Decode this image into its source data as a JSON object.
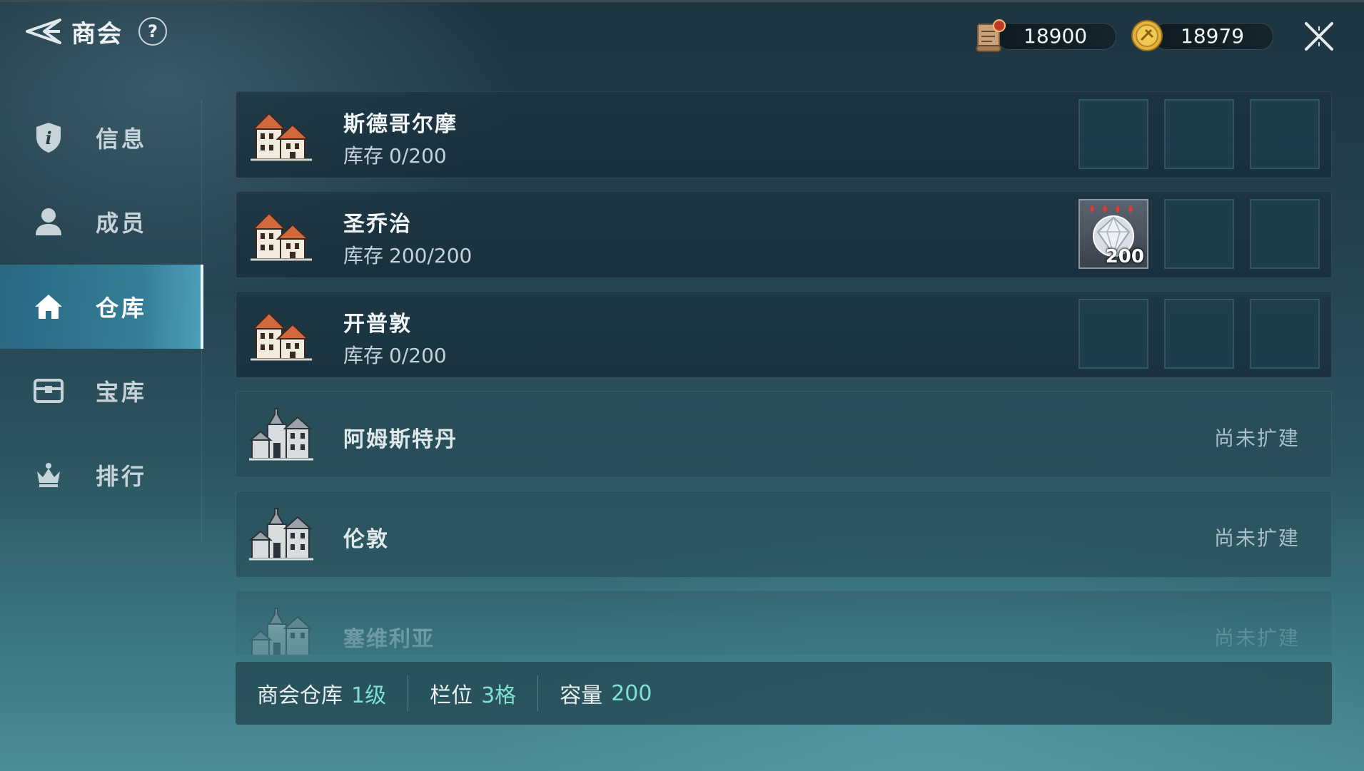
{
  "header": {
    "title": "商会",
    "help_label": "?",
    "currency_scroll_value": "18900",
    "currency_gold_value": "18979"
  },
  "sidebar": {
    "items": [
      {
        "label": "信息",
        "icon": "info-shield-icon",
        "active": false
      },
      {
        "label": "成员",
        "icon": "person-icon",
        "active": false
      },
      {
        "label": "仓库",
        "icon": "home-icon",
        "active": true
      },
      {
        "label": "宝库",
        "icon": "chest-icon",
        "active": false
      },
      {
        "label": "排行",
        "icon": "crown-icon",
        "active": false
      }
    ]
  },
  "warehouses": [
    {
      "name": "斯德哥尔摩",
      "stock_label": "库存",
      "stock": "0/200",
      "built": true,
      "slots": [
        "",
        "",
        ""
      ]
    },
    {
      "name": "圣乔治",
      "stock_label": "库存",
      "stock": "200/200",
      "built": true,
      "slots": [
        "200",
        "",
        ""
      ]
    },
    {
      "name": "开普敦",
      "stock_label": "库存",
      "stock": "0/200",
      "built": true,
      "slots": [
        "",
        "",
        ""
      ]
    },
    {
      "name": "阿姆斯特丹",
      "built": false,
      "status": "尚未扩建"
    },
    {
      "name": "伦敦",
      "built": false,
      "status": "尚未扩建"
    },
    {
      "name": "塞维利亚",
      "built": false,
      "status": "尚未扩建"
    }
  ],
  "footer": {
    "level_label": "商会仓库",
    "level_value": "1级",
    "slots_label": "栏位",
    "slots_value": "3格",
    "capacity_label": "容量",
    "capacity_value": "200"
  },
  "colors": {
    "accent_value": "#7fe0cf",
    "active_tab": "#3c96b4",
    "roof_orange": "#d2693c"
  }
}
